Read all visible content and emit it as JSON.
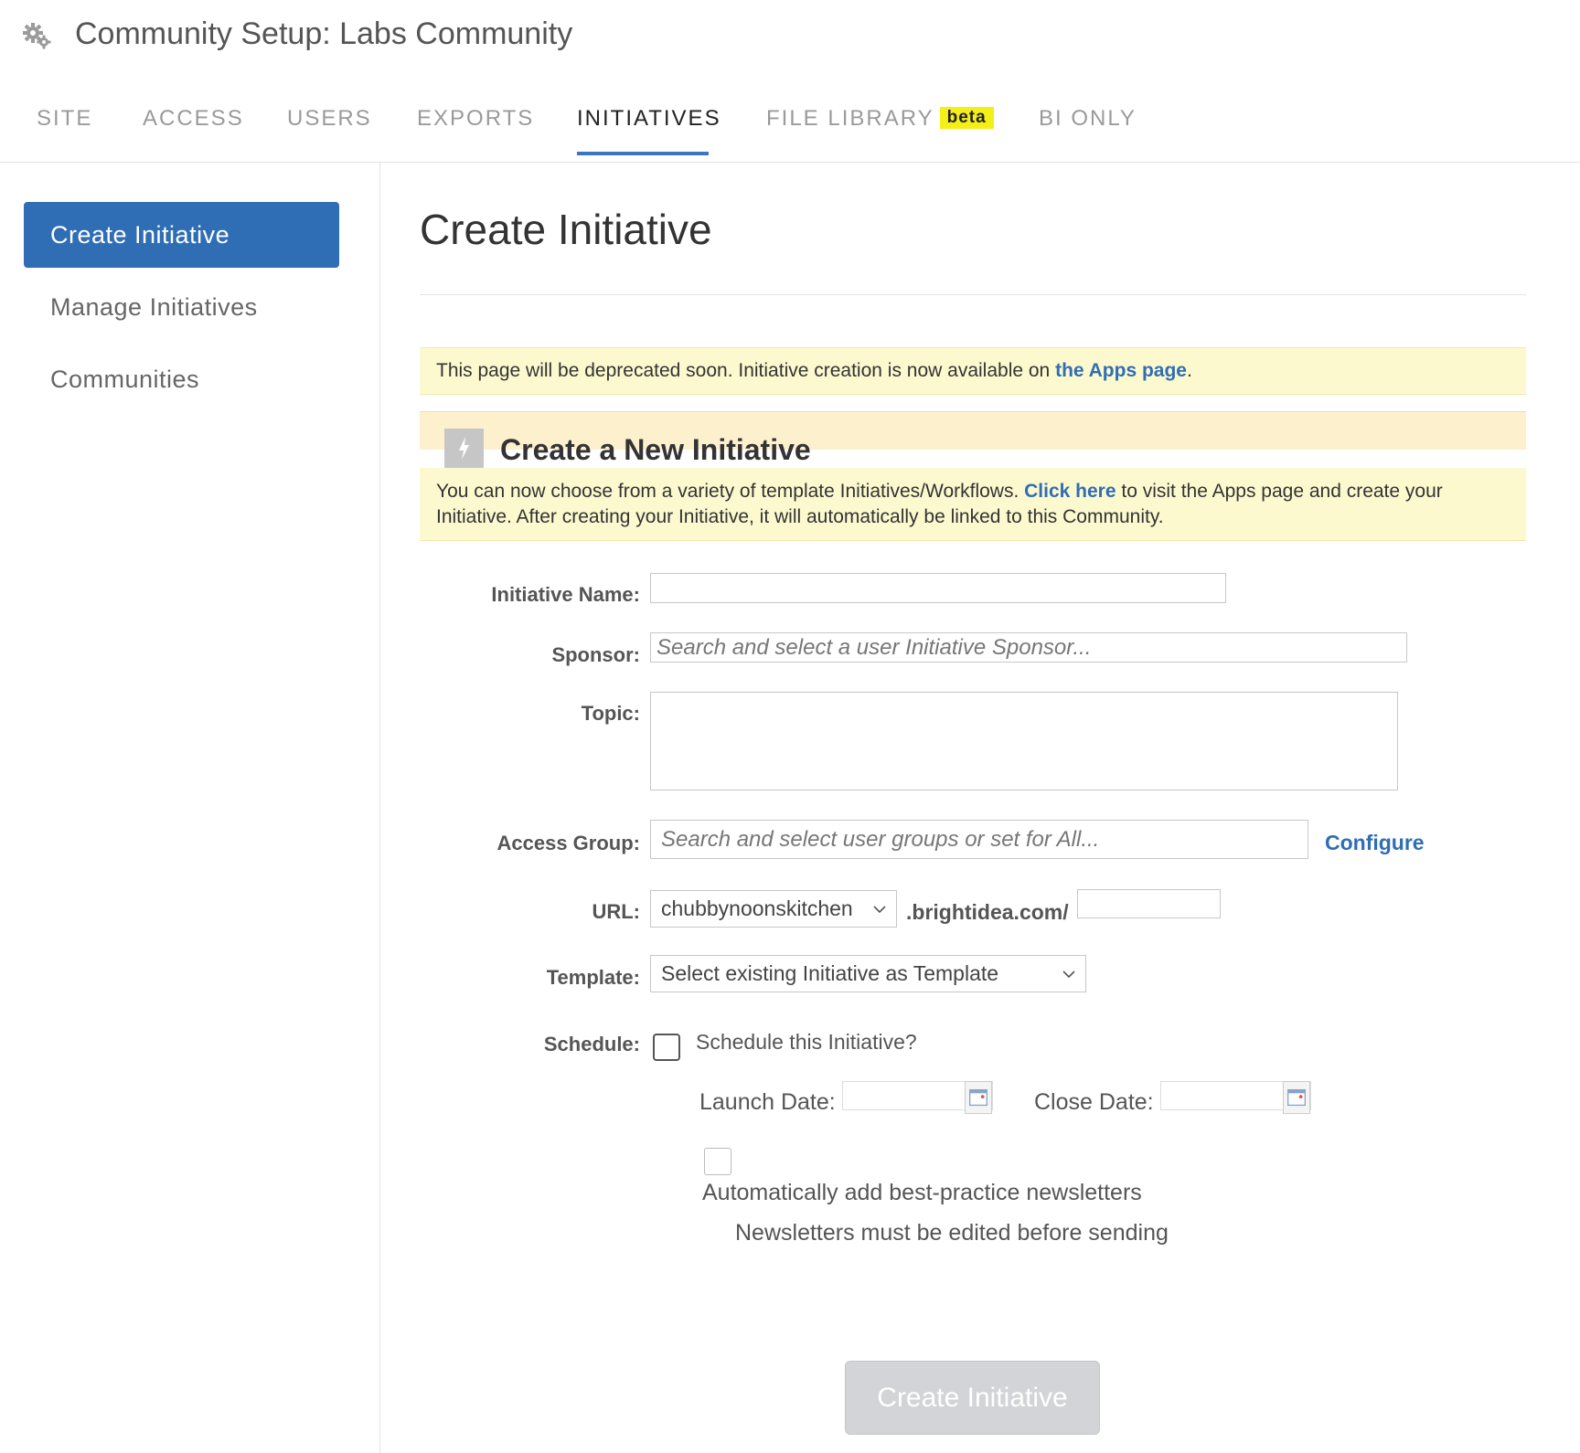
{
  "header": {
    "title": "Community Setup: Labs Community",
    "icon": "gear-icon"
  },
  "tabs": [
    {
      "label": "SITE",
      "active": false
    },
    {
      "label": "ACCESS",
      "active": false
    },
    {
      "label": "USERS",
      "active": false
    },
    {
      "label": "EXPORTS",
      "active": false
    },
    {
      "label": "INITIATIVES",
      "active": true
    },
    {
      "label": "FILE LIBRARY",
      "badge": "beta",
      "active": false
    },
    {
      "label": "BI ONLY",
      "active": false
    }
  ],
  "sidebar": {
    "items": [
      {
        "label": "Create Initiative",
        "active": true
      },
      {
        "label": "Manage Initiatives",
        "active": false
      },
      {
        "label": "Communities",
        "active": false
      }
    ]
  },
  "main": {
    "title": "Create Initiative",
    "notice": {
      "text": "This page will be deprecated soon. Initiative creation is now available on ",
      "link": "the Apps page",
      "suffix": "."
    },
    "section": {
      "title": "Create a New Initiative",
      "icon": "lightning-bolt-icon",
      "note_prefix": "You can now choose from a variety of template Initiatives/Workflows. ",
      "note_link": "Click here",
      "note_suffix": " to visit the Apps page and create your Initiative. After creating your Initiative, it will automatically be linked to this Community."
    }
  },
  "form": {
    "initiative_name": {
      "label": "Initiative Name:",
      "value": ""
    },
    "sponsor": {
      "label": "Sponsor:",
      "placeholder": "Search and select a user Initiative Sponsor..."
    },
    "topic": {
      "label": "Topic:",
      "value": ""
    },
    "access_group": {
      "label": "Access Group:",
      "placeholder": "Search and select user groups or set for All...",
      "configure": "Configure"
    },
    "url": {
      "label": "URL:",
      "selected": "chubbynoonskitchen",
      "domain": ".brightidea.com/",
      "path": ""
    },
    "template": {
      "label": "Template:",
      "selected": "Select existing Initiative as Template"
    },
    "schedule": {
      "label": "Schedule:",
      "checkbox_label": "Schedule this Initiative?",
      "checked": false,
      "launch_label": "Launch Date:",
      "close_label": "Close Date:"
    },
    "newsletters": {
      "label": "Automatically add best-practice newsletters",
      "note": "Newsletters must be edited before sending",
      "checked": false
    },
    "submit": "Create Initiative"
  },
  "colors": {
    "accent": "#2f6db5",
    "notice_bg": "#fdf9cf",
    "section_bg": "#fdf0cd",
    "beta_badge": "#f5ef19",
    "submit_disabled": "#d2d4d7"
  }
}
